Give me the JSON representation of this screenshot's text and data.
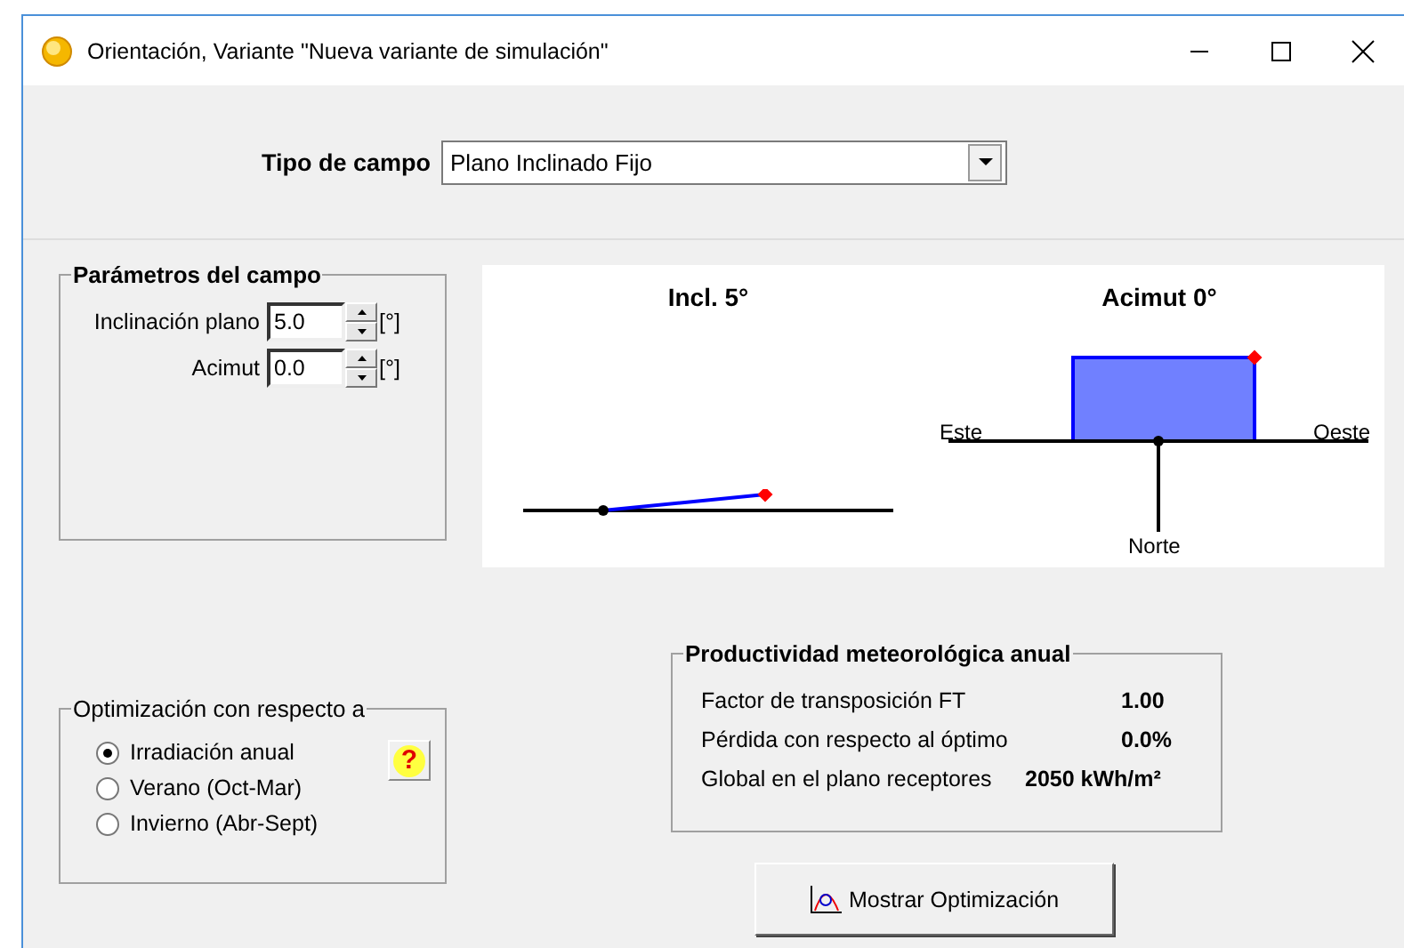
{
  "window": {
    "title": "Orientación, Variante \"Nueva variante de simulación\""
  },
  "field_type": {
    "label": "Tipo de campo",
    "value": "Plano Inclinado Fijo"
  },
  "parameters": {
    "title": "Parámetros del campo",
    "fields": [
      {
        "label": "Inclinación plano",
        "value": "5.0",
        "unit": "[°]"
      },
      {
        "label": "Acimut",
        "value": "0.0",
        "unit": "[°]"
      }
    ]
  },
  "diagram": {
    "tilt_title": "Incl. 5°",
    "azimuth_title": "Acimut 0°",
    "east": "Este",
    "west": "Oeste",
    "north": "Norte"
  },
  "optimization": {
    "title": "Optimización con respecto a",
    "help": "?",
    "options": [
      {
        "label": "Irradiación anual",
        "selected": true
      },
      {
        "label": "Verano (Oct-Mar)",
        "selected": false
      },
      {
        "label": "Invierno (Abr-Sept)",
        "selected": false
      }
    ]
  },
  "productivity": {
    "title": "Productividad meteorológica anual",
    "rows": [
      {
        "label": "Factor de transposición FT",
        "value": "1.00"
      },
      {
        "label": "Pérdida con respecto al óptimo",
        "value": "0.0%"
      },
      {
        "label": "Global en el plano receptores",
        "value": "2050 kWh/m²"
      }
    ]
  },
  "show_button": {
    "label": "Mostrar Optimización"
  }
}
